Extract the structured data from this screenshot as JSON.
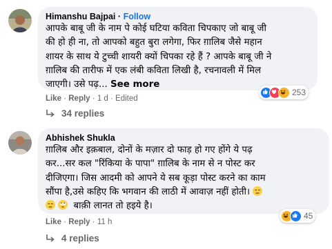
{
  "comments": [
    {
      "author": "Himanshu Bajpai",
      "follow_label": "Follow",
      "follow_separator": "·",
      "lines": [
        "आपके बाबू जी के नाम पे कोई घटिया कविता चिपकाए जो बाबू जी",
        "की हो ही ना, तो आपको बहुत बुरा लगेगा, फिर ग़ालिब जैसे महान",
        "शायर के साथ ये टुच्ची शायरी क्यों चिपका रहे हैं ? आपके बाबू जी ने",
        "ग़ालिब की तारीफ में एक लंबी कविता लिखी है, रचनावली में मिल",
        "जाएगी। उसे पढ़..."
      ],
      "see_more": "See more",
      "like": "Like",
      "reply": "Reply",
      "time": "1 d",
      "edited": "Edited",
      "reactions": [
        "like-reaction-icon",
        "love-reaction-icon",
        "haha-reaction-icon"
      ],
      "reaction_count": "253",
      "replies_label": "34 replies"
    },
    {
      "author": "Abhishek Shukla",
      "lines": [
        "ग़ालिब और इक़बाल, दोनों के मज़ार दो फाड़ हो गए होंगे ये पढ़",
        "कर...सर कल \"रिंकिया के पापा\" ग़ालिब के नाम से न पोस्ट कर",
        "दीजिएगा। जिस आदमी को आपने ये सब कूड़ा पोस्ट करने का काम",
        "सौंपा है,उसे कहिए कि भगवान की लाठी में आवाज़ नहीं होती।"
      ],
      "last_line": "बाक़ी लानत तो हइये है।",
      "inline_emojis": [
        "unamused-face-icon",
        "unamused-face-icon",
        "rolling-eyes-face-icon"
      ],
      "like": "Like",
      "reply": "Reply",
      "time": "11 h",
      "reactions": [
        "haha-reaction-icon",
        "like-reaction-icon"
      ],
      "reaction_count": "45",
      "replies_label": "4 replies"
    }
  ],
  "colors": {
    "bubble": "#f0f2f5",
    "follow": "#1b74e4",
    "meta": "#65676b",
    "like": "#1877f2",
    "love": "#f33e58",
    "haha": "#f7b125"
  }
}
